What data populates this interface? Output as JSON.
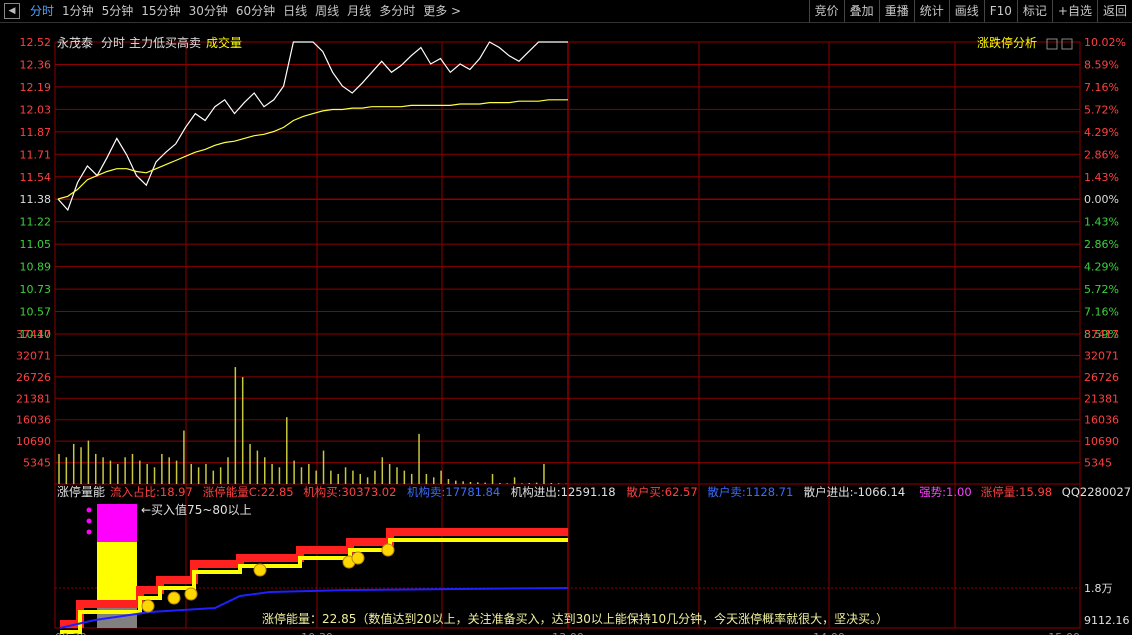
{
  "topbar": {
    "tabs": [
      "分时",
      "1分钟",
      "5分钟",
      "15分钟",
      "30分钟",
      "60分钟",
      "日线",
      "周线",
      "月线",
      "多分时",
      "更多 >"
    ],
    "active": 0,
    "right_buttons": [
      "竞价",
      "叠加",
      "重播",
      "统计",
      "画线",
      "F10",
      "标记",
      "+自选",
      "返回"
    ]
  },
  "price_panel": {
    "stock_name": "永茂泰",
    "label_fenshi": "分时",
    "label_indicator": "主力低买高卖",
    "label_volume": "成交量",
    "right_label": "涨跌停分析",
    "price_ticks": [
      "12.52",
      "12.36",
      "12.19",
      "12.03",
      "11.87",
      "11.71",
      "11.54",
      "11.38",
      "11.22",
      "11.05",
      "10.89",
      "10.73",
      "10.57",
      "10.40"
    ],
    "pct_ticks": [
      "10.02%",
      "8.59%",
      "7.16%",
      "5.72%",
      "4.29%",
      "2.86%",
      "1.43%",
      "0.00%",
      "1.43%",
      "2.86%",
      "4.29%",
      "5.72%",
      "7.16%",
      "8.59%"
    ],
    "volume_ticks": [
      "37417",
      "32071",
      "26726",
      "21381",
      "16036",
      "10690",
      "5345"
    ]
  },
  "indicator_panel": {
    "name": "涨停量能",
    "stats": [
      {
        "label": "流入占比:",
        "value": "18.97",
        "color": "#ff4040"
      },
      {
        "label": "涨停能量C:",
        "value": "22.85",
        "color": "#ff4040"
      },
      {
        "label": "机构买:",
        "value": "30373.02",
        "color": "#ff4040"
      },
      {
        "label": "机构卖:",
        "value": "17781.84",
        "color": "#3a6cff"
      },
      {
        "label": "机构进出:",
        "value": "12591.18",
        "color": "#e0e0e0"
      },
      {
        "label": "散户买:",
        "value": "62.57",
        "color": "#ff4040"
      },
      {
        "label": "散户卖:",
        "value": "1128.71",
        "color": "#3a6cff"
      },
      {
        "label": "散户进出:",
        "value": "-1066.14",
        "color": "#e0e0e0"
      },
      {
        "label": "强势:",
        "value": "1.00",
        "color": "#ff40ff"
      },
      {
        "label": "涨停量:",
        "value": "15.98",
        "color": "#ff4040"
      },
      {
        "label": "QQ2280027",
        "value": "",
        "color": "#e0e0e0"
      }
    ],
    "annotation": "←买入值75~80以上",
    "right_ticks": [
      "1.8万",
      "9112.16"
    ],
    "bottom_note": "涨停能量：22.85（数值达到20以上，关注准备买入，达到30以上能保持10几分钟，今天涨停概率就很大，坚决买。）"
  },
  "time_axis": [
    "09:30",
    "10:30",
    "13:00",
    "14:00",
    "15:00"
  ],
  "colors": {
    "grid": "#8b0000",
    "up": "#ff4040",
    "down": "#3cd23c",
    "price_line": "#ffffff",
    "avg_line": "#ffff40",
    "volume": "#c8c840",
    "blue_line": "#2020ff",
    "magenta": "#ff00ff",
    "yellow": "#ffff00",
    "gray": "#808080"
  },
  "chart_data": {
    "type": "line",
    "title": "永茂泰 分时",
    "series": [
      {
        "name": "价格",
        "values": [
          11.38,
          11.3,
          11.5,
          11.62,
          11.55,
          11.68,
          11.82,
          11.7,
          11.55,
          11.48,
          11.65,
          11.72,
          11.78,
          11.9,
          12.0,
          11.95,
          12.05,
          12.1,
          12.0,
          12.08,
          12.15,
          12.05,
          12.1,
          12.2,
          12.52,
          12.52,
          12.52,
          12.45,
          12.3,
          12.2,
          12.15,
          12.22,
          12.3,
          12.38,
          12.3,
          12.35,
          12.42,
          12.48,
          12.36,
          12.4,
          12.3,
          12.36,
          12.32,
          12.4,
          12.52,
          12.48,
          12.42,
          12.38,
          12.45,
          12.52,
          12.52,
          12.52,
          12.52
        ]
      },
      {
        "name": "均价",
        "values": [
          11.38,
          11.4,
          11.45,
          11.52,
          11.55,
          11.58,
          11.6,
          11.6,
          11.58,
          11.57,
          11.6,
          11.63,
          11.66,
          11.69,
          11.72,
          11.74,
          11.77,
          11.79,
          11.8,
          11.82,
          11.84,
          11.85,
          11.87,
          11.9,
          11.95,
          11.98,
          12.0,
          12.02,
          12.03,
          12.03,
          12.04,
          12.04,
          12.05,
          12.05,
          12.05,
          12.05,
          12.06,
          12.06,
          12.06,
          12.06,
          12.06,
          12.07,
          12.07,
          12.07,
          12.08,
          12.08,
          12.08,
          12.09,
          12.09,
          12.09,
          12.1,
          12.1,
          12.1
        ]
      }
    ],
    "volume_values": [
      9000,
      8000,
      12000,
      11000,
      13000,
      9000,
      8000,
      7000,
      6000,
      8000,
      9000,
      7000,
      6000,
      5000,
      9000,
      8000,
      7000,
      16000,
      6000,
      5000,
      6000,
      4000,
      5000,
      8000,
      35000,
      32000,
      12000,
      10000,
      8000,
      6000,
      5000,
      20000,
      7000,
      5000,
      6000,
      4000,
      10000,
      4000,
      3000,
      5000,
      4000,
      3000,
      2000,
      4000,
      8000,
      6000,
      5000,
      4000,
      3000,
      15000,
      3000,
      2000,
      4000,
      1500,
      1000,
      800,
      600,
      500,
      400,
      3000,
      300,
      200,
      2000,
      200,
      300,
      400,
      6000,
      300,
      200,
      100
    ],
    "ylim": [
      10.4,
      12.52
    ]
  }
}
